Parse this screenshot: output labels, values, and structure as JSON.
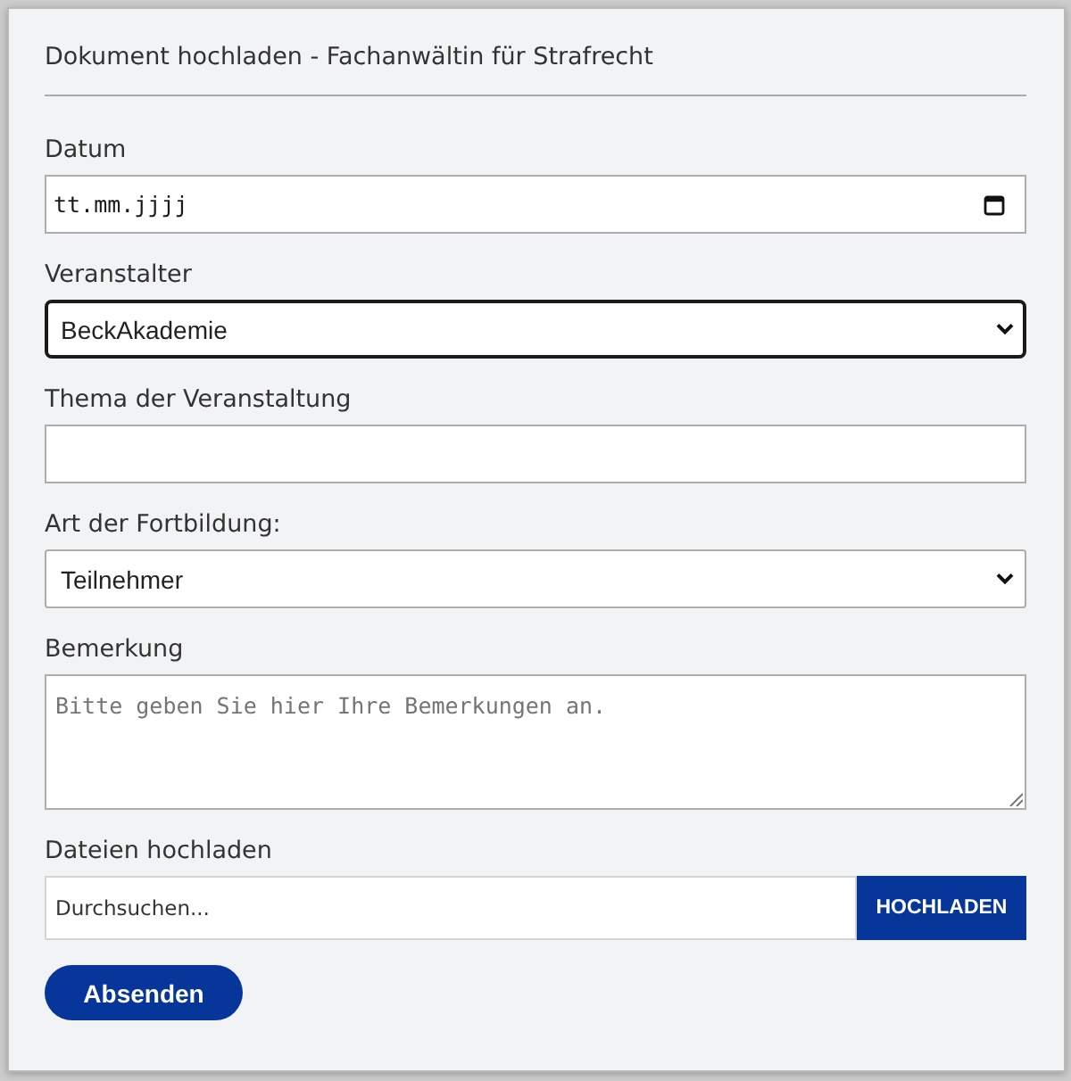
{
  "dialog": {
    "title": "Dokument hochladen - Fachanwältin für Strafrecht"
  },
  "fields": [
    {
      "kind": "date",
      "label": "Datum",
      "placeholder": "tt.mm.jjjj"
    },
    {
      "kind": "select",
      "label": "Veranstalter",
      "value": "BeckAkademie",
      "focused": true
    },
    {
      "kind": "text",
      "label": "Thema der Veranstaltung"
    },
    {
      "kind": "select",
      "label": "Art der Fortbildung:",
      "value": "Teilnehmer",
      "focused": false
    },
    {
      "kind": "textarea",
      "label": "Bemerkung",
      "placeholder": "Bitte geben Sie hier Ihre Bemerkungen an."
    },
    {
      "kind": "file",
      "label": "Dateien hochladen",
      "placeholder": "Durchsuchen...",
      "button": "HOCHLADEN"
    }
  ],
  "submit": "Absenden"
}
